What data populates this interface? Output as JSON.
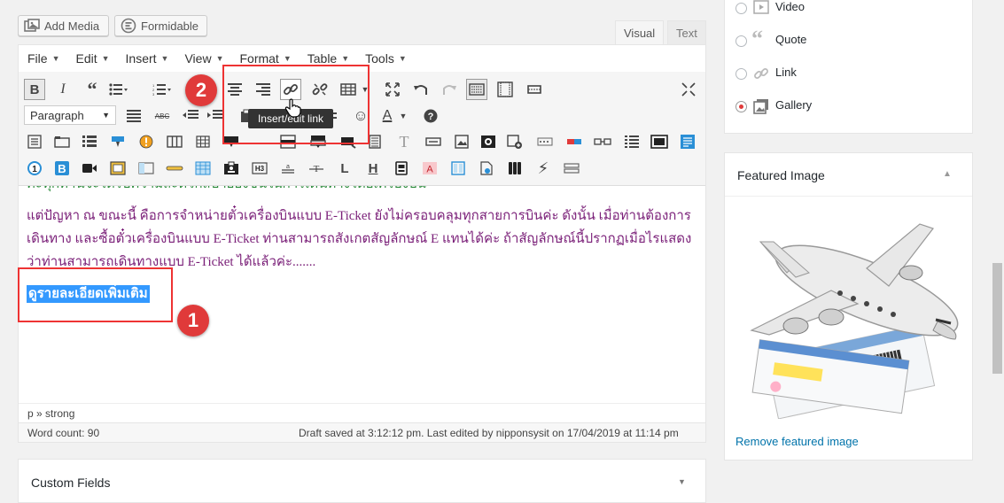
{
  "media_buttons": {
    "add_media": "Add Media",
    "formidable": "Formidable"
  },
  "editor_tabs": {
    "visual": "Visual",
    "text": "Text"
  },
  "menubar": [
    "File",
    "Edit",
    "Insert",
    "View",
    "Format",
    "Table",
    "Tools"
  ],
  "toolbar": {
    "paragraph_select": "Paragraph",
    "tooltip": "Insert/edit link"
  },
  "content": {
    "top_line_partial": "ค่ะทุกท่านจะได้รับความสะดวกสบายยิ่งขึ้นในการเดินทางโดยเครื่องบิน",
    "paragraph": "แต่ปัญหา ณ ขณะนี้ คือการจำหน่ายตั๋วเครื่องบินแบบ E-Ticket ยังไม่ครอบคลุมทุกสายการบินค่ะ ดังนั้น เมื่อท่านต้องการเดินทาง และซื้อตั๋วเครื่องบินแบบ E-Ticket ท่านสามารถสังเกตสัญลักษณ์ E แทนได้ค่ะ ถ้าสัญลักษณ์นี้ปรากฏเมื่อไรแสดงว่าท่านสามารถเดินทางแบบ E-Ticket ได้แล้วค่ะ.......",
    "selected_link_text": "ดูรายละเอียดเพิ่มเติม"
  },
  "status_path": "p » strong",
  "word_count": "Word count: 90",
  "draft_info": "Draft saved at 3:12:12 pm. Last edited by nipponsysit on 17/04/2019 at 11:14 pm",
  "custom_fields": {
    "title": "Custom Fields"
  },
  "format_options": [
    {
      "label": "Video",
      "icon": "video-icon",
      "selected": false
    },
    {
      "label": "Quote",
      "icon": "quote-icon",
      "selected": false
    },
    {
      "label": "Link",
      "icon": "link-icon",
      "selected": false
    },
    {
      "label": "Gallery",
      "icon": "gallery-icon",
      "selected": true
    }
  ],
  "featured_image": {
    "title": "Featured Image",
    "remove_link": "Remove featured image"
  },
  "annotations": {
    "one": "1",
    "two": "2"
  },
  "colors": {
    "accent_blue": "#0073aa",
    "highlight": "#3399ff",
    "thai_text": "#7a1f78",
    "annotation_red": "#e03a3a"
  }
}
